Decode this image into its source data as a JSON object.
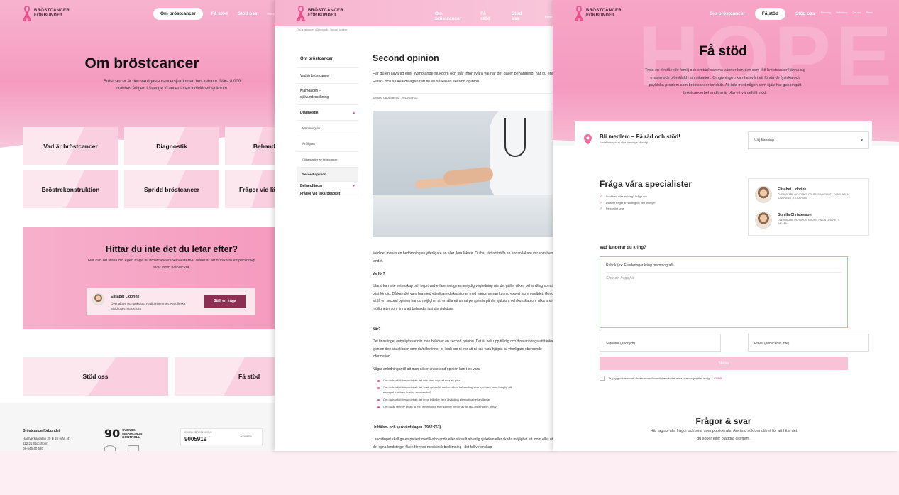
{
  "brand": {
    "logo_line1": "BRÖSTCANCER",
    "logo_line2": "FÖRBUNDET",
    "accent": "#e8508a",
    "dark_button": "#8c2f52"
  },
  "panel1": {
    "nav": [
      "Om bröstcancer",
      "Få stöd",
      "Stöd oss",
      "Föreni"
    ],
    "title": "Om bröstcancer",
    "lead": "Bröstcancer är den vanligaste cancersjukdomen hos kvinnor. Nära 8 000 drabbas årligen i Sverige. Cancer är en individuell sjukdom.",
    "cards": [
      "Vad är bröstcancer",
      "Diagnostik",
      "Behand",
      "Bröstrekonstruktion",
      "Spridd bröstcancer",
      "Frågor vid lä"
    ],
    "search_title": "Hittar du inte det du letar efter?",
    "search_text": "Här kan du ställa din egen fråga till bröstcancerspecialisterna. Målet är att du ska få ett personligt svar inom två veckor.",
    "expert_name": "Elisabet Lidbrink",
    "expert_role": "Överläkare och onkolog, Radiumhemmet, Karolinska Sjukhuset, Stockholm",
    "ask_button": "Ställ en fråga",
    "bottom_cards": [
      "Stöd oss",
      "Få stöd"
    ],
    "footer_org": "Bröstcancerförbundet",
    "footer_addr": [
      "Hantverkargatan 25 B 1tr (vån. 4)",
      "112 21 Stockholm",
      "08-546 40 530"
    ],
    "footer_90_line1": "SVENSK",
    "footer_90_line2": "INSAMLINGS",
    "footer_90_line3": "KONTROLL",
    "swish_label": "SWISH SPONTANGÅVA",
    "swish_number": "9005919",
    "swish_copy": "KOPIERA"
  },
  "panel2": {
    "nav": [
      "Om bröstcancer",
      "Få stöd",
      "Stöd oss",
      "Förening"
    ],
    "breadcrumb": "Om bröstcancer  /  Diagnostik  /  Second opinion",
    "sidebar": [
      {
        "label": "Om bröstcancer",
        "kind": "b"
      },
      {
        "label": "Vad är bröstcancer",
        "kind": "n"
      },
      {
        "label": "Klämdagen – självundersökning",
        "kind": "n"
      },
      {
        "label": "Diagnostik",
        "kind": "b",
        "chev": "▴"
      },
      {
        "label": "Mammografi",
        "kind": "s"
      },
      {
        "label": "Ärftlighet",
        "kind": "s"
      },
      {
        "label": "Olika stadier av bröstcancer",
        "kind": "s"
      },
      {
        "label": "Second opinion",
        "kind": "act"
      },
      {
        "label": "Behandlingar",
        "kind": "n",
        "chev": "▾"
      },
      {
        "label": "Frågor vid läkarbesöket",
        "kind": "n"
      }
    ],
    "title": "Second opinion",
    "intro": "Har du en allvarlig eller livshotande sjukdom och står inför svåra val när det gäller behandling, har du enligt Hälso- och sjukvårdslagen rätt till en så kallad second opinion.",
    "updated": "Senast uppdaterad: 2019-03-03",
    "p1": "Med det menas en bedömning av ytterligare en eller flera läkare. Du har rätt att träffa en annan läkare var som helst i landet.",
    "h_why": "Varför?",
    "p2": "Ibland kan inte vetenskap och beprövad erfarenhet ge en entydig vägledning när det gäller vilken behandling som är bäst för dig. Då kan det vara bra med ytterligare diskussioner med någon annan kunnig expert inom området. Genom att få en second opinion har du möjlighet att erhålla ett annat perspektiv på din sjukdom och kunskap om vilka andra möjligheter som finns att behandla just din sjukdom.",
    "h_when": "När?",
    "p3": "Det finns inget entydigt svar när man behöver en second opinion. Det är helt upp till dig och dina anhöriga att tänka igenom den situationen som du/ni befinner er i och om ni tror att ni kan vara hjälpta av ytterligare oberoende information.",
    "p4": "Några anledningar till att man söker en second opinion kan t ex vara:",
    "reasons": [
      "Om du har fått beskedet att det inte finns mycket mer att göra",
      "Om du har fått beskedet att det är ett gränsfall mellan vilken behandling som kan vara mest lämplig (till exempel tumören är näst an operabel)",
      "Om du har fått beskedet att det finns två eller flera likvärdiga alternativa behandlingar",
      "Om du är i behov av att få mer information eller känner behov av att tala med någon annan"
    ],
    "h_law": "Ur Hälso- och sjukvårdslagen (1982:763)",
    "p5": "Landstinget skall ge en patient med livshotande eller särskilt allvarlig sjukdom eller skada möjlighet att inom eller utom det egna landstinget få en förnyad medicinsk bedömning i det fall vetenskap"
  },
  "panel3": {
    "nav": [
      "Om bröstcancer",
      "Få stöd",
      "Stöd oss"
    ],
    "subnav": [
      "Förening",
      "Webbshop",
      "Om oss",
      "Press"
    ],
    "bg_text": "HOPE",
    "title": "Få stöd",
    "lead": "Trots en förstående familj och omtänksamma vänner kan den som fått bröstcancer känna sig ensam och oförstådd i sin situation. Omgivningen kan ha svårt att förstå de fysiska och psykiska problem som bröstcancer innebär. Att tala med någon som själv har genomgått bröstcancerbehandling är ofta ett värdefullt stöd.",
    "member_title": "Bli medlem – Få råd och stöd!",
    "member_sub": "Kontakta någon av våra föreningar nära dig!",
    "member_select": "Välj förening",
    "spec_title": "Fråga våra specialister",
    "benefits": [
      "Snabbast eller anhörig? Fråga oss",
      "Du som frågar är naturligtvis helt anonym",
      "Personligt svar"
    ],
    "experts": [
      {
        "name": "Elisabet Lidbrink",
        "role": "Överläkare och onkolog, Radiumhemmet, Karolinska Sjukhuset, Stockholm"
      },
      {
        "name": "Gunilla Christenson",
        "role": "Överläkare och bröstkirurg, Falun lasarett, Dalarna"
      }
    ],
    "question_label": "Vad funderar du kring?",
    "subject_placeholder": "Rubrik (ex: Funderingar kring mammografi)",
    "question_placeholder": "Skriv din fråga här",
    "signature_placeholder": "Signatur (anonym)",
    "email_placeholder": "Email (publiceras inte)",
    "send_label": "Skicka",
    "consent_prefix": "Ja, jag godkänner att Bröstcancerförbundet använder mina personuppgifter enligt",
    "consent_link": "GDPR",
    "faq_title": "Frågor & svar",
    "faq_text": "Här lagras alla frågor och svar som publicerats. Använd sökformuläret för att hitta det du söker eller bläddra dig fram."
  }
}
